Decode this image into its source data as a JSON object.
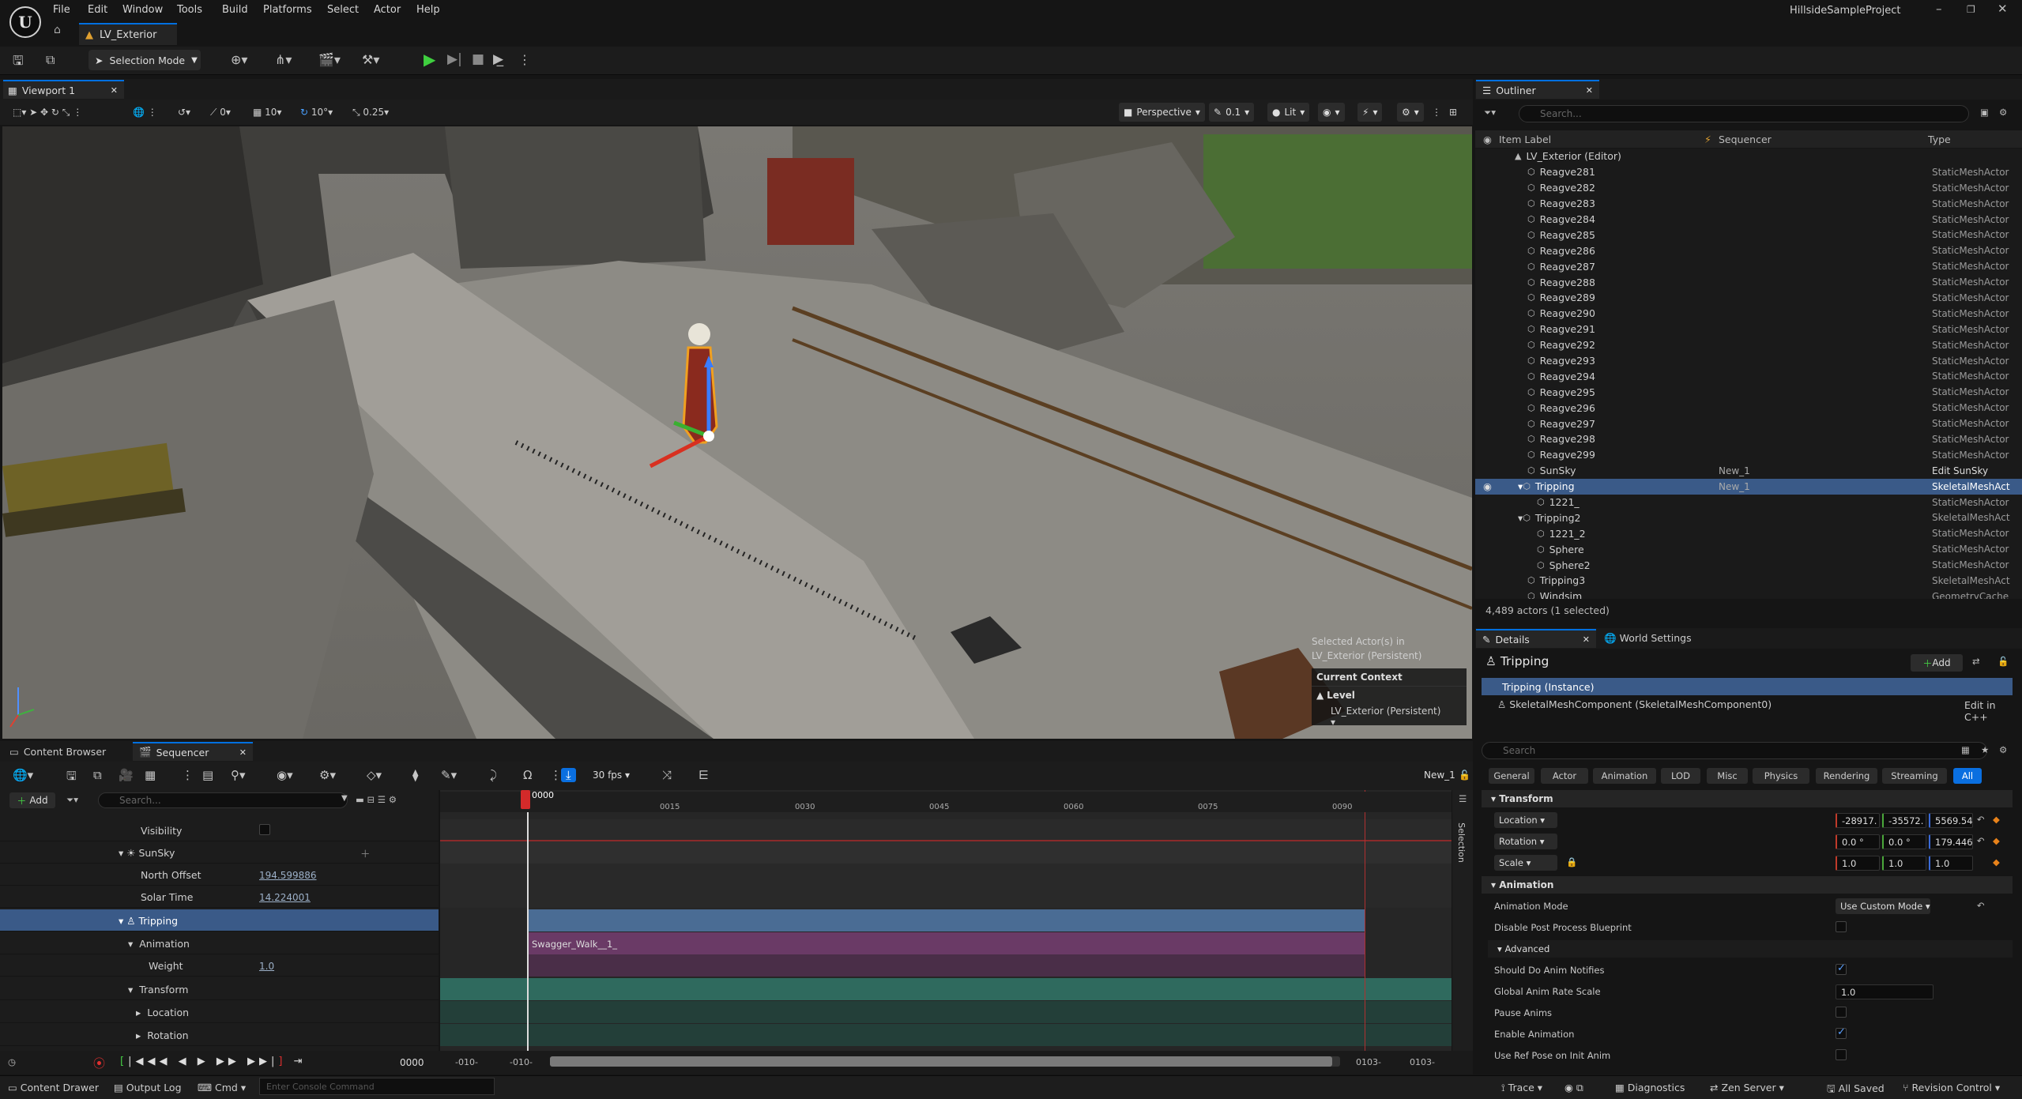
{
  "menu": {
    "items": [
      "File",
      "Edit",
      "Window",
      "Tools",
      "Build",
      "Platforms",
      "Select",
      "Actor",
      "Help"
    ],
    "project_name": "HillsideSampleProject"
  },
  "level_tab": {
    "label": "LV_Exterior"
  },
  "toolbar": {
    "selection_mode": "Selection Mode"
  },
  "viewport": {
    "tab_label": "Viewport 1",
    "toolbar": {
      "rotate_snap": "0",
      "grid_snap": "10",
      "angle_snap": "10°",
      "scale_snap": "0.25",
      "view_mode": "Perspective",
      "cam_speed": "0.1",
      "lighting": "Lit"
    },
    "selected_info": [
      "Selected Actor(s) in",
      "LV_Exterior (Persistent)"
    ],
    "current_context": "Current Context",
    "level_label": "Level",
    "level_value": "LV_Exterior (Persistent)"
  },
  "outliner": {
    "tab_label": "Outliner",
    "search_placeholder": "Search...",
    "columns": {
      "label": "Item Label",
      "sequencer": "Sequencer",
      "type": "Type"
    },
    "root": "LV_Exterior (Editor)",
    "rows": [
      {
        "label": "Reagve281",
        "type": "StaticMeshActor",
        "seq": "",
        "indent": 2
      },
      {
        "label": "Reagve282",
        "type": "StaticMeshActor",
        "seq": "",
        "indent": 2
      },
      {
        "label": "Reagve283",
        "type": "StaticMeshActor",
        "seq": "",
        "indent": 2
      },
      {
        "label": "Reagve284",
        "type": "StaticMeshActor",
        "seq": "",
        "indent": 2
      },
      {
        "label": "Reagve285",
        "type": "StaticMeshActor",
        "seq": "",
        "indent": 2
      },
      {
        "label": "Reagve286",
        "type": "StaticMeshActor",
        "seq": "",
        "indent": 2
      },
      {
        "label": "Reagve287",
        "type": "StaticMeshActor",
        "seq": "",
        "indent": 2
      },
      {
        "label": "Reagve288",
        "type": "StaticMeshActor",
        "seq": "",
        "indent": 2
      },
      {
        "label": "Reagve289",
        "type": "StaticMeshActor",
        "seq": "",
        "indent": 2
      },
      {
        "label": "Reagve290",
        "type": "StaticMeshActor",
        "seq": "",
        "indent": 2
      },
      {
        "label": "Reagve291",
        "type": "StaticMeshActor",
        "seq": "",
        "indent": 2
      },
      {
        "label": "Reagve292",
        "type": "StaticMeshActor",
        "seq": "",
        "indent": 2
      },
      {
        "label": "Reagve293",
        "type": "StaticMeshActor",
        "seq": "",
        "indent": 2
      },
      {
        "label": "Reagve294",
        "type": "StaticMeshActor",
        "seq": "",
        "indent": 2
      },
      {
        "label": "Reagve295",
        "type": "StaticMeshActor",
        "seq": "",
        "indent": 2
      },
      {
        "label": "Reagve296",
        "type": "StaticMeshActor",
        "seq": "",
        "indent": 2
      },
      {
        "label": "Reagve297",
        "type": "StaticMeshActor",
        "seq": "",
        "indent": 2
      },
      {
        "label": "Reagve298",
        "type": "StaticMeshActor",
        "seq": "",
        "indent": 2
      },
      {
        "label": "Reagve299",
        "type": "StaticMeshActor",
        "seq": "",
        "indent": 2
      },
      {
        "label": "SunSky",
        "type": "Edit SunSky",
        "seq": "New_1",
        "indent": 2
      },
      {
        "label": "Tripping",
        "type": "SkeletalMeshAct",
        "seq": "New_1",
        "indent": 1,
        "selected": true
      },
      {
        "label": "1221_",
        "type": "StaticMeshActor",
        "seq": "",
        "indent": 3
      },
      {
        "label": "Tripping2",
        "type": "SkeletalMeshAct",
        "seq": "",
        "indent": 1
      },
      {
        "label": "1221_2",
        "type": "StaticMeshActor",
        "seq": "",
        "indent": 3
      },
      {
        "label": "Sphere",
        "type": "StaticMeshActor",
        "seq": "",
        "indent": 3
      },
      {
        "label": "Sphere2",
        "type": "StaticMeshActor",
        "seq": "",
        "indent": 3
      },
      {
        "label": "Tripping3",
        "type": "SkeletalMeshAct",
        "seq": "",
        "indent": 2
      },
      {
        "label": "Windsim",
        "type": "GeometryCache",
        "seq": "",
        "indent": 2
      }
    ],
    "count": "4,489 actors (1 selected)"
  },
  "details": {
    "tab_label": "Details",
    "world_settings_label": "World Settings",
    "title": "Tripping",
    "add_label": "Add",
    "instance": "Tripping (Instance)",
    "component": "SkeletalMeshComponent (SkeletalMeshComponent0)",
    "edit_cpp": "Edit in C++",
    "search_placeholder": "Search",
    "filters": [
      "General",
      "Actor",
      "Animation",
      "LOD",
      "Misc",
      "Physics",
      "Rendering",
      "Streaming",
      "All"
    ],
    "transform": {
      "section": "Transform",
      "location_label": "Location",
      "location": [
        "-28917.",
        "-35572.",
        "5569.54"
      ],
      "rotation_label": "Rotation",
      "rotation": [
        "0.0 °",
        "0.0 °",
        "179.446"
      ],
      "scale_label": "Scale",
      "scale": [
        "1.0",
        "1.0",
        "1.0"
      ]
    },
    "animation": {
      "section": "Animation",
      "mode_label": "Animation Mode",
      "mode_value": "Use Custom Mode",
      "disable_pp_label": "Disable Post Process Blueprint",
      "advanced": "Advanced",
      "notifies_label": "Should Do Anim Notifies",
      "rate_label": "Global Anim Rate Scale",
      "rate_value": "1.0",
      "pause_label": "Pause Anims",
      "enable_label": "Enable Animation",
      "refpose_label": "Use Ref Pose on Init Anim"
    }
  },
  "bottom": {
    "content_browser_tab": "Content Browser",
    "sequencer_tab": "Sequencer",
    "fps": "30 fps",
    "sequence_name": "New_1",
    "add_label": "Add",
    "search_placeholder": "Search...",
    "tracks": {
      "visibility": "Visibility",
      "sunsky": "SunSky",
      "north_offset_label": "North Offset",
      "north_offset": "194.599886",
      "solar_time_label": "Solar Time",
      "solar_time": "14.224001",
      "tripping": "Tripping",
      "animation": "Animation",
      "weight_label": "Weight",
      "weight": "1.0",
      "transform": "Transform",
      "location": "Location",
      "rotation": "Rotation"
    },
    "clip_label": "Swagger_Walk__1_",
    "playhead": "0000",
    "ticks": [
      "0015",
      "0030",
      "0045",
      "0060",
      "0075",
      "0090"
    ],
    "selection_label": "Selection",
    "transport": {
      "frame": "0000",
      "start_a": "-010-",
      "start_b": "-010-",
      "end_a": "0103-",
      "end_b": "0103-"
    }
  },
  "status": {
    "content_drawer": "Content Drawer",
    "output_log": "Output Log",
    "cmd": "Cmd",
    "console_placeholder": "Enter Console Command",
    "trace": "Trace",
    "diagnostics": "Diagnostics",
    "zen": "Zen Server",
    "saved": "All Saved",
    "revision": "Revision Control"
  },
  "colors": {
    "accent": "#0070e0",
    "selection": "#3a5a88",
    "clip_purple": "#6a3a66",
    "transform_teal": "#2f6a5e",
    "track_blue": "#4a6c94"
  }
}
